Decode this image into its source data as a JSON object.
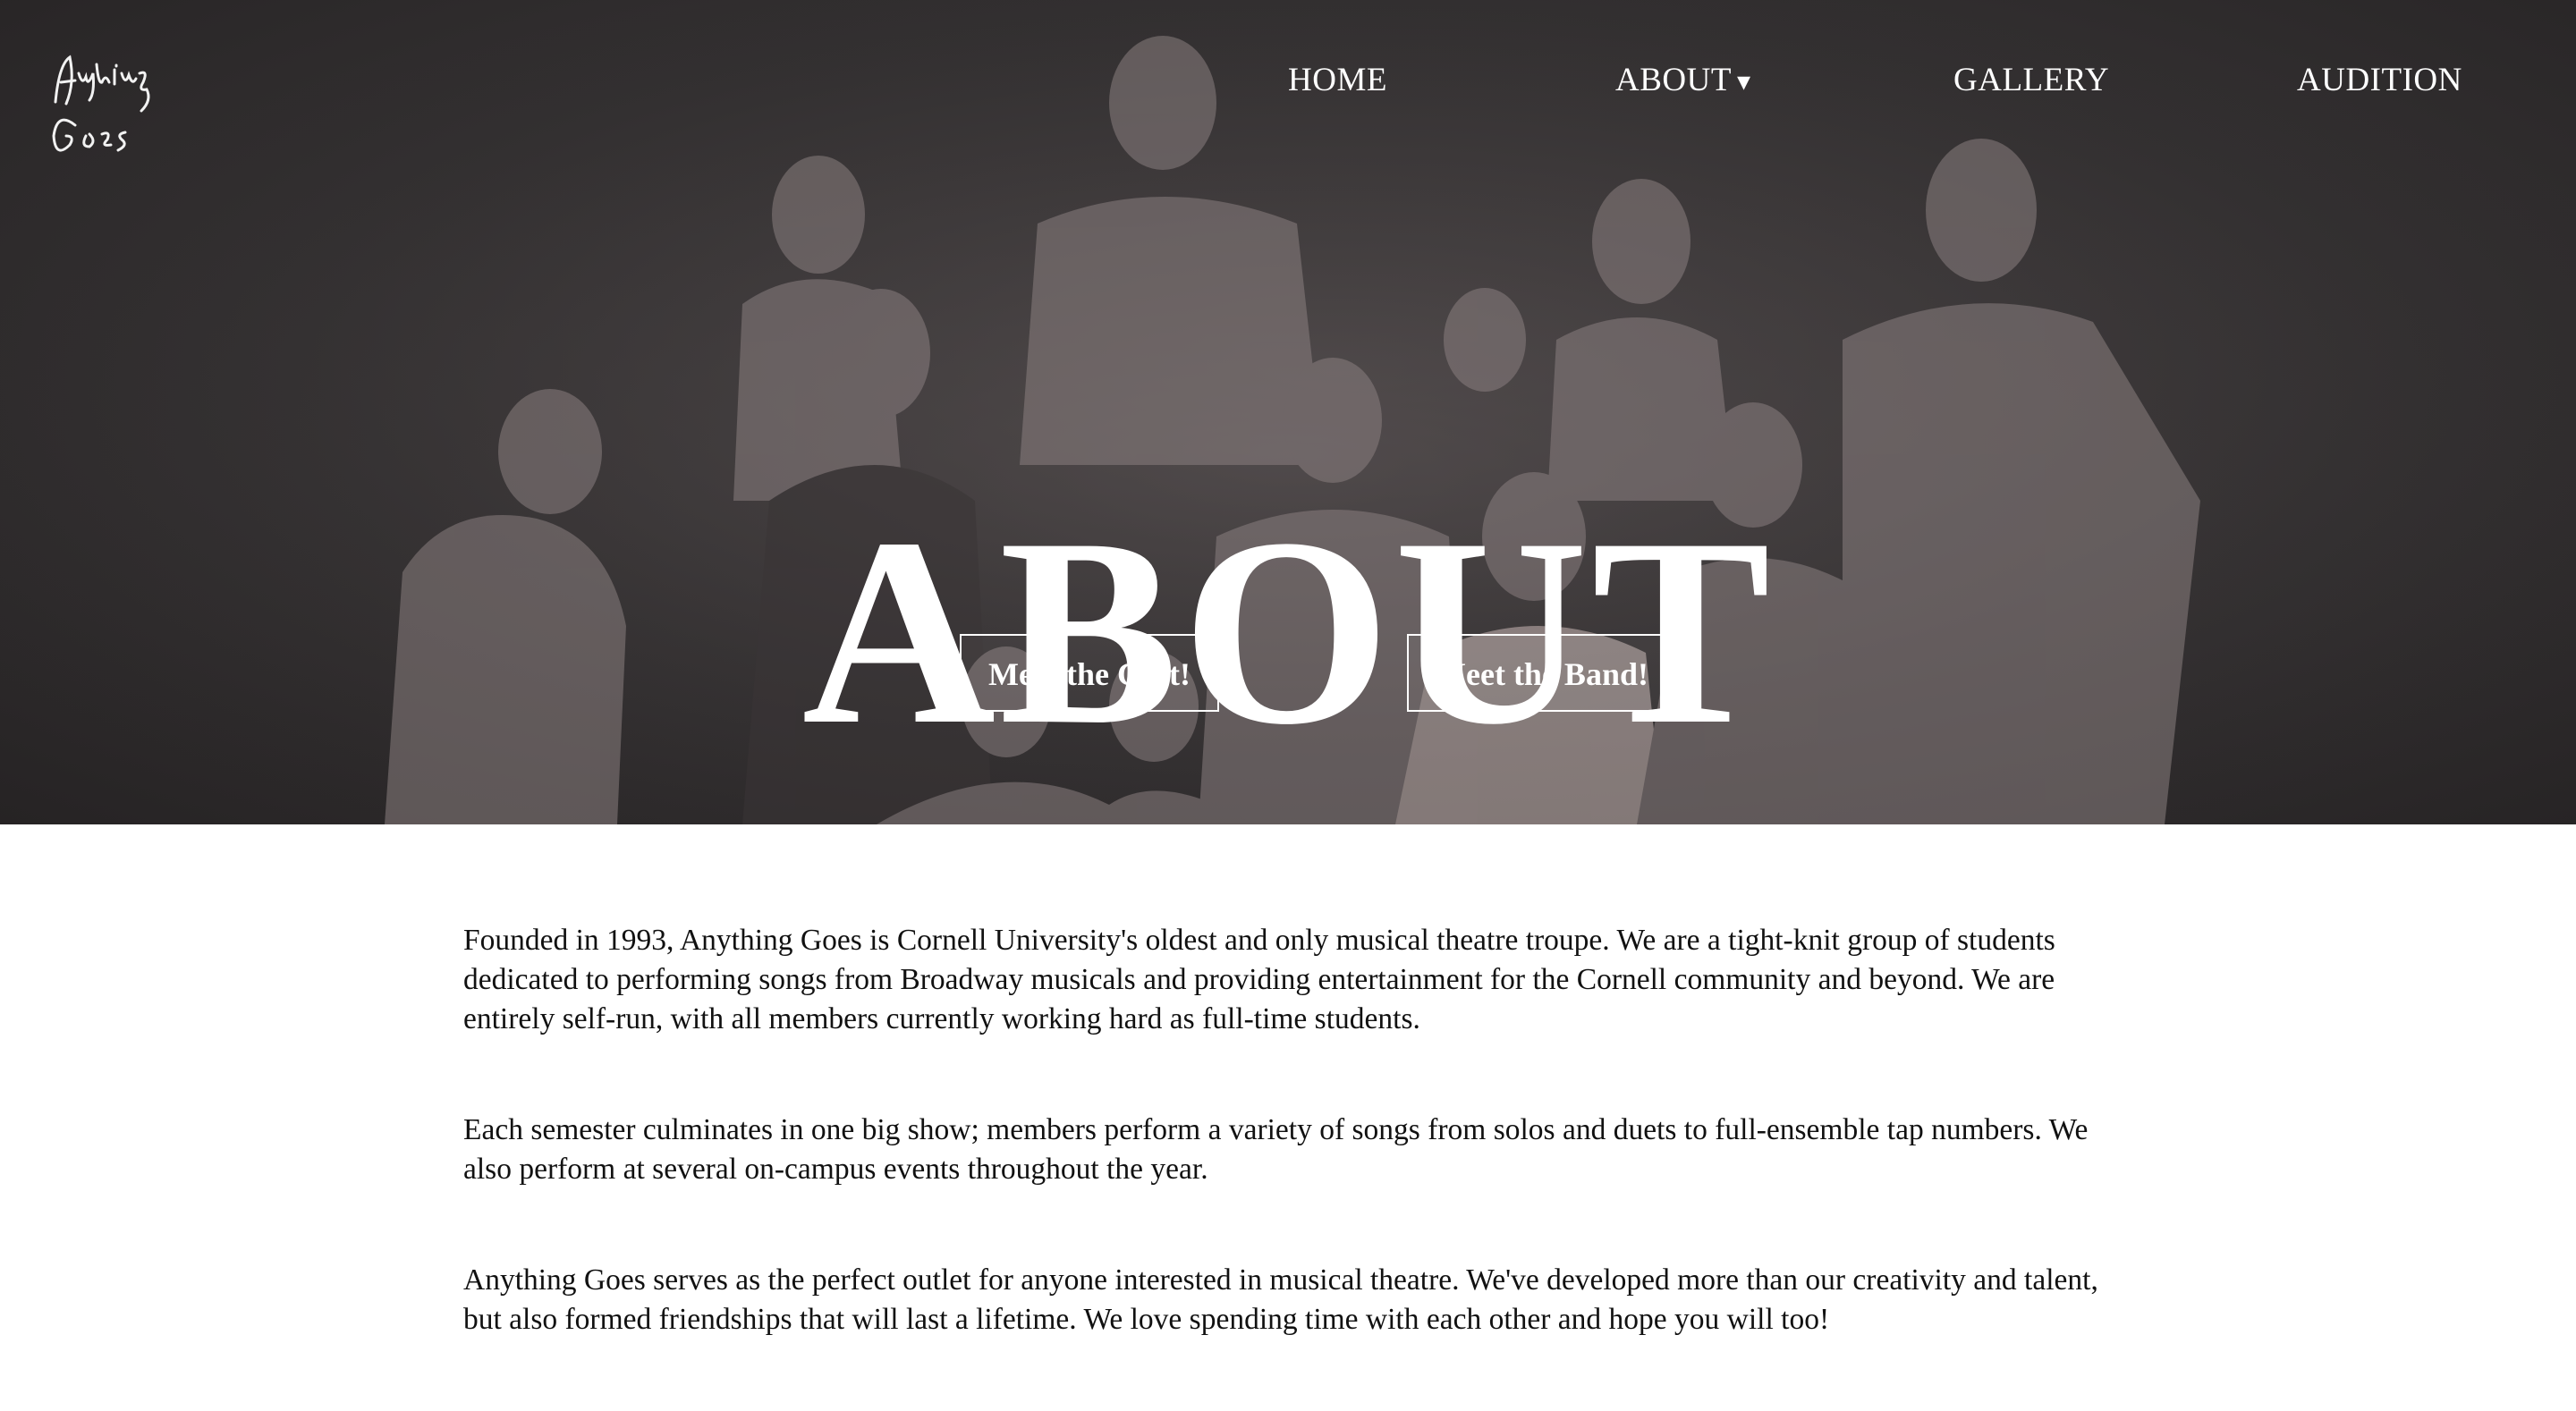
{
  "nav": {
    "items": [
      {
        "label": "HOME"
      },
      {
        "label": "ABOUT",
        "caret": "▾"
      },
      {
        "label": "GALLERY"
      },
      {
        "label": "AUDITION"
      }
    ]
  },
  "logo": {
    "icon": "anything-goes-logo-icon"
  },
  "hero": {
    "title": "ABOUT",
    "buttons": [
      {
        "label": "Meet the Cast!"
      },
      {
        "label": "Meet the Band!"
      }
    ]
  },
  "content": {
    "paragraphs": [
      "Founded in 1993, Anything Goes is Cornell University's oldest and only musical theatre troupe. We are a tight-knit group of students dedicated to performing songs from Broadway musicals and providing entertainment for the Cornell community and beyond. We are entirely self-run, with all members currently working hard as full-time students.",
      "Each semester culminates in one big show; members perform a variety of songs from solos and duets to full-ensemble tap numbers. We also perform at several on-campus events throughout the year.",
      "Anything Goes serves as the perfect outlet for anyone interested in musical theatre. We've developed more than our creativity and talent, but also formed friendships that will last a lifetime. We love spending time with each other and hope you will too!"
    ]
  },
  "colors": {
    "hero_background": "#333031",
    "text": "#111111",
    "nav_text": "#ffffff"
  }
}
